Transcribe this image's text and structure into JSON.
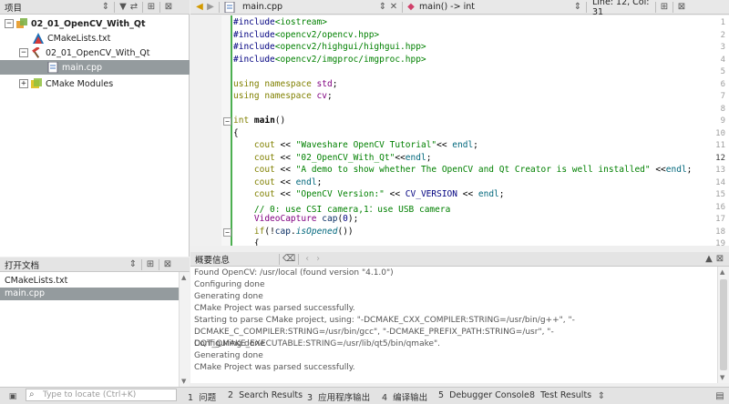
{
  "project_pane": {
    "title": "项目",
    "tree": [
      {
        "label": "02_01_OpenCV_With_Qt",
        "expander": "−",
        "bold": true
      },
      {
        "label": "CMakeLists.txt"
      },
      {
        "label": "02_01_OpenCV_With_Qt",
        "expander": "−"
      },
      {
        "label": "main.cpp",
        "selected": true
      },
      {
        "label": "CMake Modules",
        "expander": "+"
      }
    ]
  },
  "docs_pane": {
    "title": "打开文档",
    "items": [
      {
        "label": "CMakeLists.txt"
      },
      {
        "label": "main.cpp",
        "selected": true
      }
    ]
  },
  "editor_bar": {
    "file_name": "main.cpp",
    "symbol": "main() -> int",
    "position": "Line: 12, Col: 31"
  },
  "editor": {
    "line_numbers": [
      "1",
      "2",
      "3",
      "4",
      "5",
      "6",
      "7",
      "8",
      "9",
      "10",
      "11",
      "12",
      "13",
      "14",
      "15",
      "16",
      "17",
      "18",
      "19"
    ],
    "current_line": "12",
    "folds": {
      "9": "−",
      "18": "−"
    }
  },
  "output_pane": {
    "title": "概要信息",
    "lines": [
      "Found OpenCV: /usr/local (found version \"4.1.0\")",
      "Configuring done",
      "Generating done",
      "CMake Project was parsed successfully.",
      "Starting to parse CMake project, using: \"-DCMAKE_CXX_COMPILER:STRING=/usr/bin/g++\", \"-DCMAKE_C_COMPILER:STRING=/usr/bin/gcc\", \"-DCMAKE_PREFIX_PATH:STRING=/usr\", \"-DQT_QMAKE_EXECUTABLE:STRING=/usr/lib/qt5/bin/qmake\".",
      "Configuring done",
      "Generating done",
      "CMake Project was parsed successfully."
    ]
  },
  "status_bar": {
    "locator_placeholder": "Type to locate (Ctrl+K)",
    "tabs": [
      {
        "num": "1",
        "label": "问题"
      },
      {
        "num": "2",
        "label": "Search Results"
      },
      {
        "num": "3",
        "label": "应用程序输出"
      },
      {
        "num": "4",
        "label": "编译输出"
      },
      {
        "num": "5",
        "label": "Debugger Console"
      },
      {
        "num": "8",
        "label": "Test Results"
      }
    ]
  },
  "colors": {
    "selection": "#949b9e",
    "modified_bar": "#4caf50",
    "keyword": "#808000",
    "string": "#008000"
  }
}
